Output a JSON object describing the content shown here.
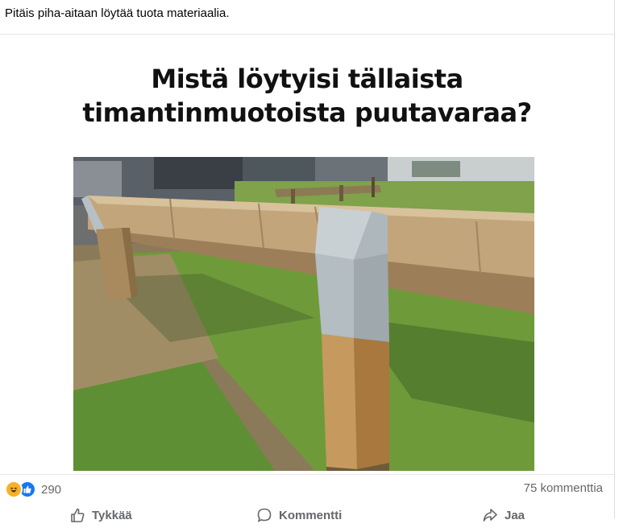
{
  "post": {
    "text": "Pitäis piha-aitaan löytää tuota materiaalia.",
    "image": {
      "headline_line1": "Mistä löytyisi tällaista",
      "headline_line2": "timantinmuotoista puutavaraa?"
    }
  },
  "engagement": {
    "reactions": [
      "haha-icon",
      "like-icon"
    ],
    "reaction_count": "290",
    "comment_count": "75 kommenttia"
  },
  "actions": {
    "like_label": "Tykkää",
    "comment_label": "Kommentti",
    "share_label": "Jaa"
  },
  "colors": {
    "like_blue": "#1877f2",
    "haha_yellow": "#f7b125",
    "secondary_text": "#65676b"
  }
}
